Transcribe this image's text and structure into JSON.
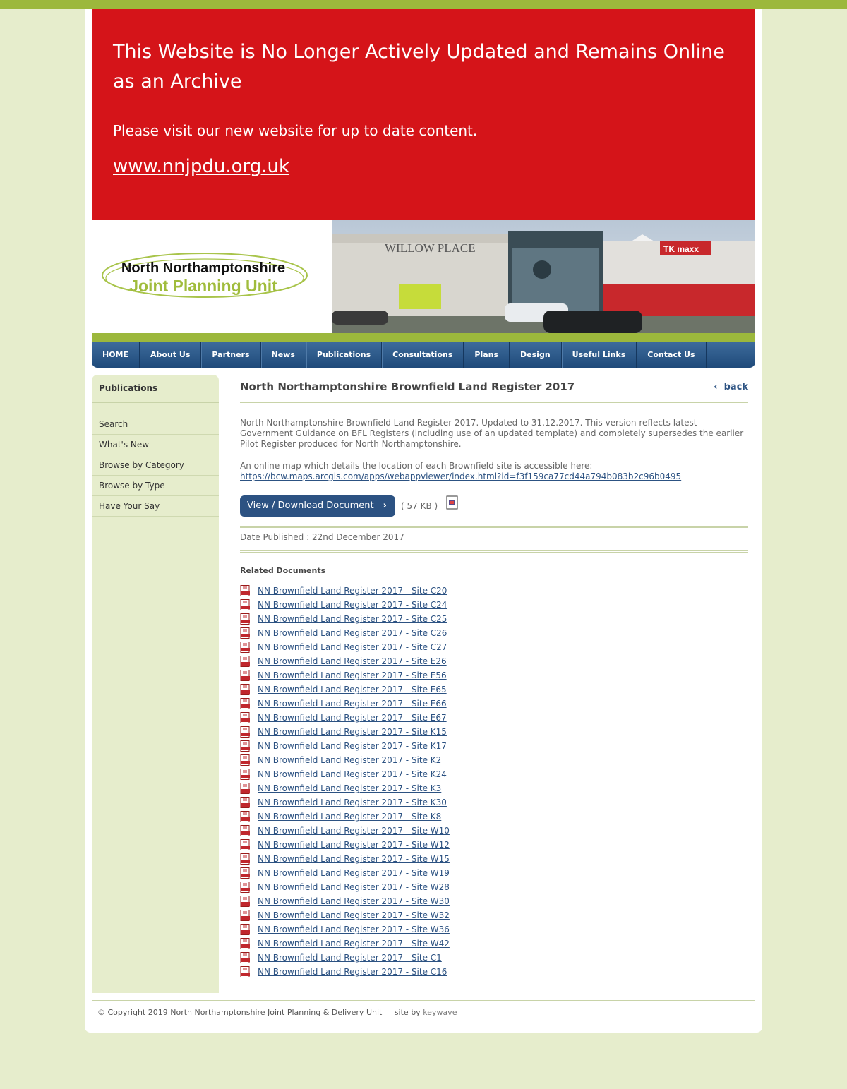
{
  "archive": {
    "title": "This Website is No Longer Actively Updated and Remains Online as an Archive",
    "subtitle": "Please visit our new website for up to date content.",
    "link": "www.nnjpdu.org.uk"
  },
  "logo": {
    "line1": "North Northamptonshire",
    "line2": "Joint Planning Unit"
  },
  "banner": {
    "sign_left": "WILLOW PLACE",
    "sign_right": "TK maxx"
  },
  "nav": [
    "HOME",
    "About Us",
    "Partners",
    "News",
    "Publications",
    "Consultations",
    "Plans",
    "Design",
    "Useful Links",
    "Contact Us"
  ],
  "sidebar": {
    "title": "Publications",
    "items": [
      "Search",
      "What's New",
      "Browse by Category",
      "Browse by Type",
      "Have Your Say"
    ]
  },
  "main": {
    "title": "North Northamptonshire Brownfield Land Register 2017",
    "back": "back",
    "description": "North Northamptonshire Brownfield Land Register 2017. Updated to 31.12.2017. This version reflects latest Government Guidance on BFL Registers (including use of an updated template) and completely supersedes the earlier Pilot Register produced for North Northamptonshire.",
    "map_text": "An online map which details the location of each Brownfield site is accessible here:",
    "map_url": "https://bcw.maps.arcgis.com/apps/webappviewer/index.html?id=f3f159ca77cd44a794b083b2c96b0495",
    "download_label": "View / Download Document",
    "filesize": "( 57 KB )",
    "date_published": "Date Published : 22nd December 2017",
    "related_heading": "Related Documents",
    "related": [
      "NN Brownfield Land Register 2017 - Site C20",
      "NN Brownfield Land Register 2017 - Site C24",
      "NN Brownfield Land Register 2017 - Site C25",
      "NN Brownfield Land Register 2017 - Site C26",
      "NN Brownfield Land Register 2017 - Site C27",
      "NN Brownfield Land Register 2017 - Site E26",
      "NN Brownfield Land Register 2017 - Site E56",
      "NN Brownfield Land Register 2017 - Site E65",
      "NN Brownfield Land Register 2017 - Site E66",
      "NN Brownfield Land Register 2017 - Site E67",
      "NN Brownfield Land Register 2017 - Site K15",
      "NN Brownfield Land Register 2017 - Site K17",
      "NN Brownfield Land Register 2017 - Site K2",
      "NN Brownfield Land Register 2017 - Site K24",
      "NN Brownfield Land Register 2017 - Site K3",
      "NN Brownfield Land Register 2017 - Site K30",
      "NN Brownfield Land Register 2017 - Site K8",
      "NN Brownfield Land Register 2017 - Site W10",
      "NN Brownfield Land Register 2017 - Site W12",
      "NN Brownfield Land Register 2017 - Site W15",
      "NN Brownfield Land Register 2017 - Site W19",
      "NN Brownfield Land Register 2017 - Site W28",
      "NN Brownfield Land Register 2017 - Site W30",
      "NN Brownfield Land Register 2017 - Site W32",
      "NN Brownfield Land Register 2017 - Site W36",
      "NN Brownfield Land Register 2017 - Site W42",
      "NN Brownfield Land Register 2017 - Site C1",
      "NN Brownfield Land Register 2017 - Site C16"
    ]
  },
  "footer": {
    "copyright": "© Copyright 2019 North Northamptonshire Joint Planning & Delivery Unit",
    "site_by": "site by",
    "site_by_link": "keywave"
  },
  "colors": {
    "brand_green": "#9cb83c",
    "archive_red": "#d51419",
    "nav_blue": "#2c5282",
    "page_bg": "#e6edcc"
  }
}
